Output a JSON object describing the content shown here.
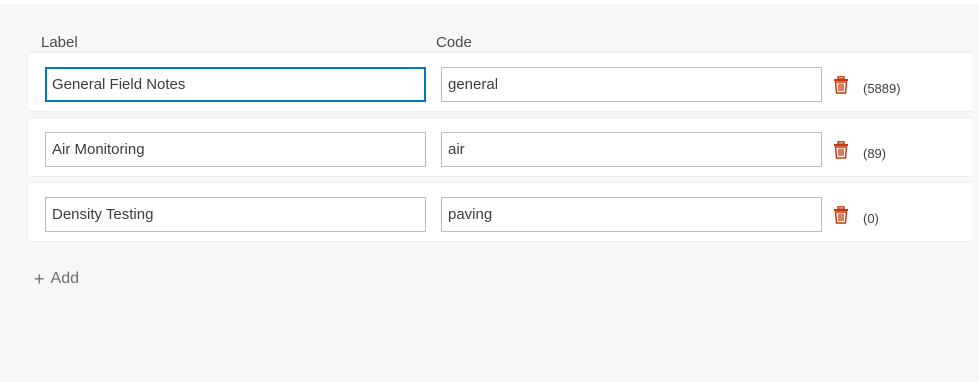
{
  "headers": {
    "label": "Label",
    "code": "Code"
  },
  "rows": [
    {
      "label": "General Field Notes",
      "code": "general",
      "count": "(5889)"
    },
    {
      "label": "Air Monitoring",
      "code": "air",
      "count": "(89)"
    },
    {
      "label": "Density Testing",
      "code": "paving",
      "count": "(0)"
    }
  ],
  "add": {
    "icon": "+",
    "label": "Add"
  },
  "icons": {
    "delete": "trash-icon"
  },
  "colors": {
    "focus": "#0079c1",
    "delete": "#c4380f"
  }
}
